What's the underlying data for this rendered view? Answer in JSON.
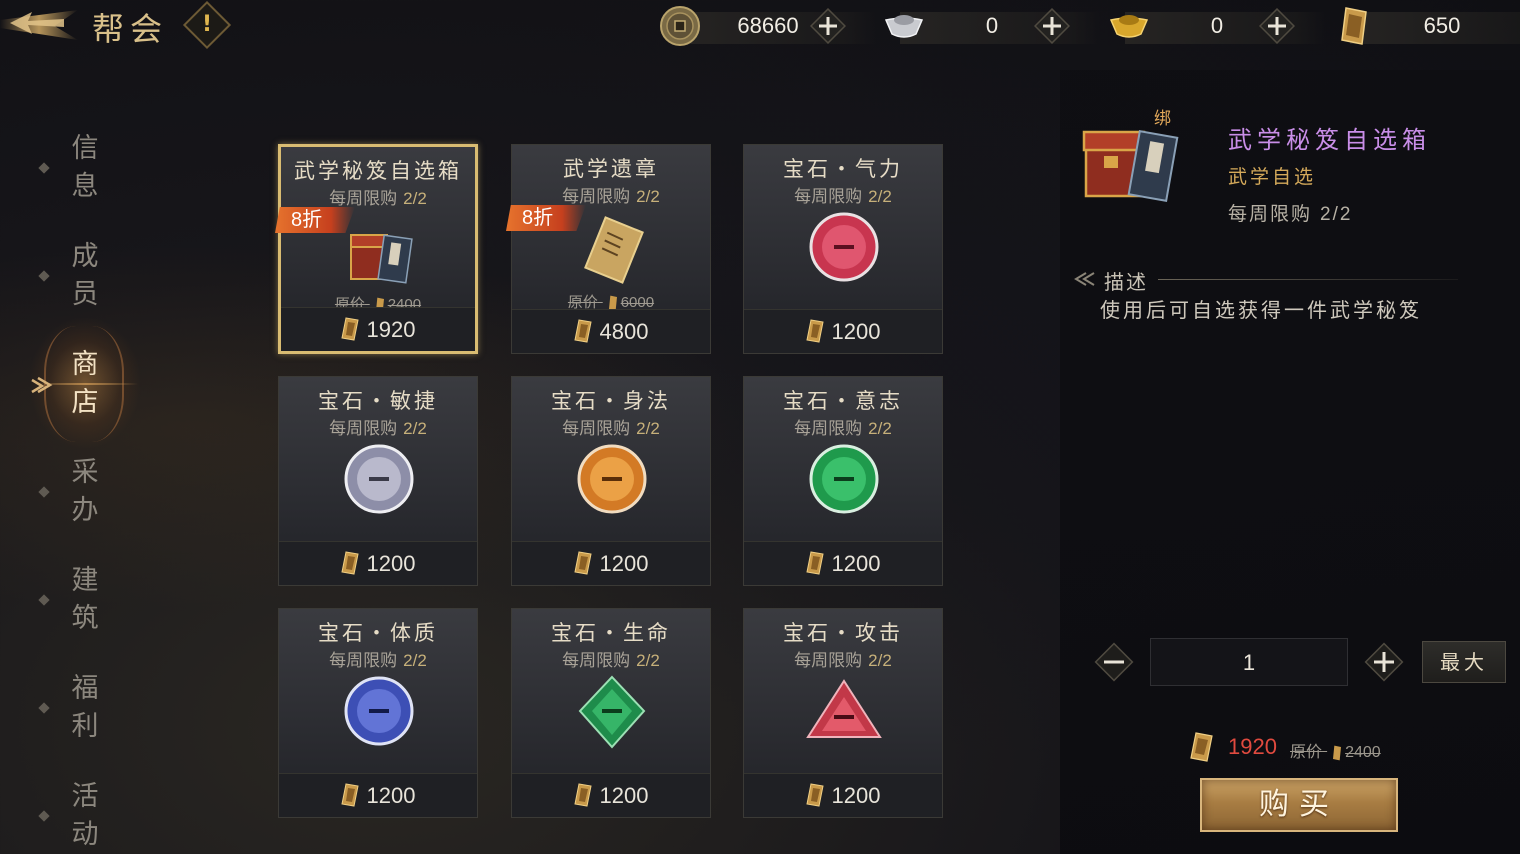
{
  "header": {
    "title": "帮会",
    "info_mark": "!"
  },
  "currencies": [
    {
      "id": "copper-coin",
      "icon": "copper-coin-icon",
      "value": "68660"
    },
    {
      "id": "silver-ingot",
      "icon": "silver-ingot-icon",
      "value": "0"
    },
    {
      "id": "gold-ingot",
      "icon": "gold-ingot-icon",
      "value": "0"
    },
    {
      "id": "guild-token",
      "icon": "guild-token-icon",
      "value": "650"
    }
  ],
  "plus_symbol": "+",
  "sidebar": {
    "active": "商店",
    "items": [
      {
        "label": "信息"
      },
      {
        "label": "成员"
      },
      {
        "label": "商店"
      },
      {
        "label": "采办"
      },
      {
        "label": "建筑"
      },
      {
        "label": "福利"
      },
      {
        "label": "活动"
      }
    ]
  },
  "shop": {
    "limit_label": "每周限购",
    "orig_label": "原价",
    "items": [
      {
        "name": "武学秘笈自选箱",
        "limit": "2/2",
        "discount": "8折",
        "orig_price": "2400",
        "price": "1920",
        "icon": "chest-icon",
        "selected": true
      },
      {
        "name": "武学遗章",
        "limit": "2/2",
        "discount": "8折",
        "orig_price": "6000",
        "price": "4800",
        "icon": "scroll-icon",
        "selected": false
      },
      {
        "name": "宝石・气力",
        "limit": "2/2",
        "discount": "",
        "orig_price": "",
        "price": "1200",
        "icon": "gem-red-icon",
        "selected": false
      },
      {
        "name": "宝石・敏捷",
        "limit": "2/2",
        "discount": "",
        "orig_price": "",
        "price": "1200",
        "icon": "gem-silver-icon",
        "selected": false
      },
      {
        "name": "宝石・身法",
        "limit": "2/2",
        "discount": "",
        "orig_price": "",
        "price": "1200",
        "icon": "gem-orange-icon",
        "selected": false
      },
      {
        "name": "宝石・意志",
        "limit": "2/2",
        "discount": "",
        "orig_price": "",
        "price": "1200",
        "icon": "gem-green-icon",
        "selected": false
      },
      {
        "name": "宝石・体质",
        "limit": "2/2",
        "discount": "",
        "orig_price": "",
        "price": "1200",
        "icon": "gem-blue-icon",
        "selected": false
      },
      {
        "name": "宝石・生命",
        "limit": "2/2",
        "discount": "",
        "orig_price": "",
        "price": "1200",
        "icon": "gem-diamond-green-icon",
        "selected": false
      },
      {
        "name": "宝石・攻击",
        "limit": "2/2",
        "discount": "",
        "orig_price": "",
        "price": "1200",
        "icon": "gem-triangle-red-icon",
        "selected": false
      }
    ]
  },
  "detail": {
    "bind_tag": "绑",
    "name": "武学秘笈自选箱",
    "category": "武学自选",
    "limit_label": "每周限购",
    "limit": "2/2",
    "desc_heading": "描述",
    "desc": "使用后可自选获得一件武学秘笈",
    "quantity": "1",
    "minus_symbol": "−",
    "plus_symbol": "+",
    "max_label": "最大",
    "total_price": "1920",
    "orig_label": "原价",
    "orig_price": "2400",
    "buy_label": "购买"
  },
  "colors": {
    "accent_gold": "#d9bc72",
    "rare_purple": "#c98ee8",
    "price_red": "#e04a3f",
    "discount_orange": "#e6732d"
  }
}
